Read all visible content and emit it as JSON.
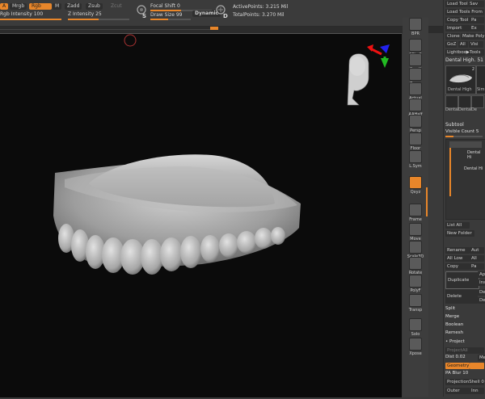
{
  "topbar": {
    "btn_a": "A",
    "mrgb": "Mrgb",
    "rgb": "Rgb",
    "m": "M",
    "zadd": "Zadd",
    "zsub": "Zsub",
    "zcut": "Zcut",
    "rgb_intensity_label": "Rgb Intensity",
    "rgb_intensity_value": "100",
    "z_intensity_label": "Z Intensity",
    "z_intensity_value": "25",
    "focal_shift_label": "Focal Shift",
    "focal_shift_value": "0",
    "draw_size_label": "Draw Size",
    "draw_size_value": "99",
    "dynamic": "Dynamic",
    "active_points": "ActivePoints: 3.215 Mil",
    "total_points": "TotalPoints: 3.270 Mil",
    "s_letter": "S",
    "d_letter": "D"
  },
  "tools": [
    {
      "label": "BPR",
      "icon": "render-sphere-icon",
      "active": false
    },
    {
      "label": "SPix 3",
      "icon": "spix-icon",
      "active": false
    },
    {
      "label": "Scroll",
      "icon": "scroll-icon",
      "active": false
    },
    {
      "label": "Zoom",
      "icon": "zoom-icon",
      "active": false
    },
    {
      "label": "Actual",
      "icon": "actual-icon",
      "active": false
    },
    {
      "label": "AAHalf",
      "icon": "aahalf-icon",
      "active": false
    },
    {
      "label": "Persp",
      "icon": "persp-icon",
      "active": false
    },
    {
      "label": "Floor",
      "icon": "floor-icon",
      "active": false
    },
    {
      "label": "L.Sym",
      "icon": "lsym-icon",
      "active": false
    },
    {
      "label": "Qxyz",
      "icon": "xyz-icon",
      "active": true
    },
    {
      "label": "Frame",
      "icon": "frame-icon",
      "active": false
    },
    {
      "label": "Move",
      "icon": "move-icon",
      "active": false
    },
    {
      "label": "Scale3D",
      "icon": "scale-icon",
      "active": false
    },
    {
      "label": "Rotate",
      "icon": "rotate-icon",
      "active": false
    },
    {
      "label": "PolyF",
      "icon": "polyf-icon",
      "active": false
    },
    {
      "label": "Transp",
      "icon": "transp-icon",
      "active": false
    },
    {
      "label": "Solo",
      "icon": "solo-icon",
      "active": false
    },
    {
      "label": "Xpose",
      "icon": "xpose-icon",
      "active": false
    }
  ],
  "rpanel": {
    "load_tool": "Load Tool",
    "save": "Sav",
    "load_from_project": "Load Tools From Pr",
    "copy_tool": "Copy Tool",
    "paste": "Pa",
    "import": "Import",
    "export": "Ex",
    "clone": "Clone",
    "make_poly": "Make Poly",
    "goz": "GoZ",
    "all": "All",
    "visible": "Visi",
    "lightbox_tools": "Lightbox▶Tools",
    "dental_high": "Dental High.",
    "dental_high_num": "51",
    "thumb_label_1": "Dental High",
    "thumb_label_2": "Sim",
    "thumb_count": "2",
    "mini_1": "Dental",
    "mini_2": "Dental",
    "mini_3": "De",
    "subtool": "Subtool",
    "visible_count_label": "Visible Count",
    "visible_count_value": "5",
    "subtool_1": "Dental Hi",
    "subtool_2": "Dental Hi",
    "list_all": "List All",
    "new_folder": "New Folder",
    "rename": "Rename",
    "auto": "Aut",
    "all_low": "All Low",
    "all_right": "All",
    "copy": "Copy",
    "paste2": "Pa",
    "duplicate": "Duplicate",
    "append": "Ap",
    "insert": "Ins",
    "delete": "Delete",
    "del_r1": "De",
    "del_r2": "De",
    "split": "Split",
    "merge": "Merge",
    "boolean": "Boolean",
    "remesh": "Remesh",
    "project": "Project",
    "project_all": "ProjectAll",
    "dist_label": "Dist",
    "dist_value": "0.02",
    "mean": "Me",
    "geometry": "Geometry",
    "pa_blur_label": "PA Blur",
    "pa_blur_value": "10",
    "projection_shell_label": "ProjectionShell",
    "projection_shell_value": "0",
    "outer": "Outer",
    "inner": "Inn"
  }
}
